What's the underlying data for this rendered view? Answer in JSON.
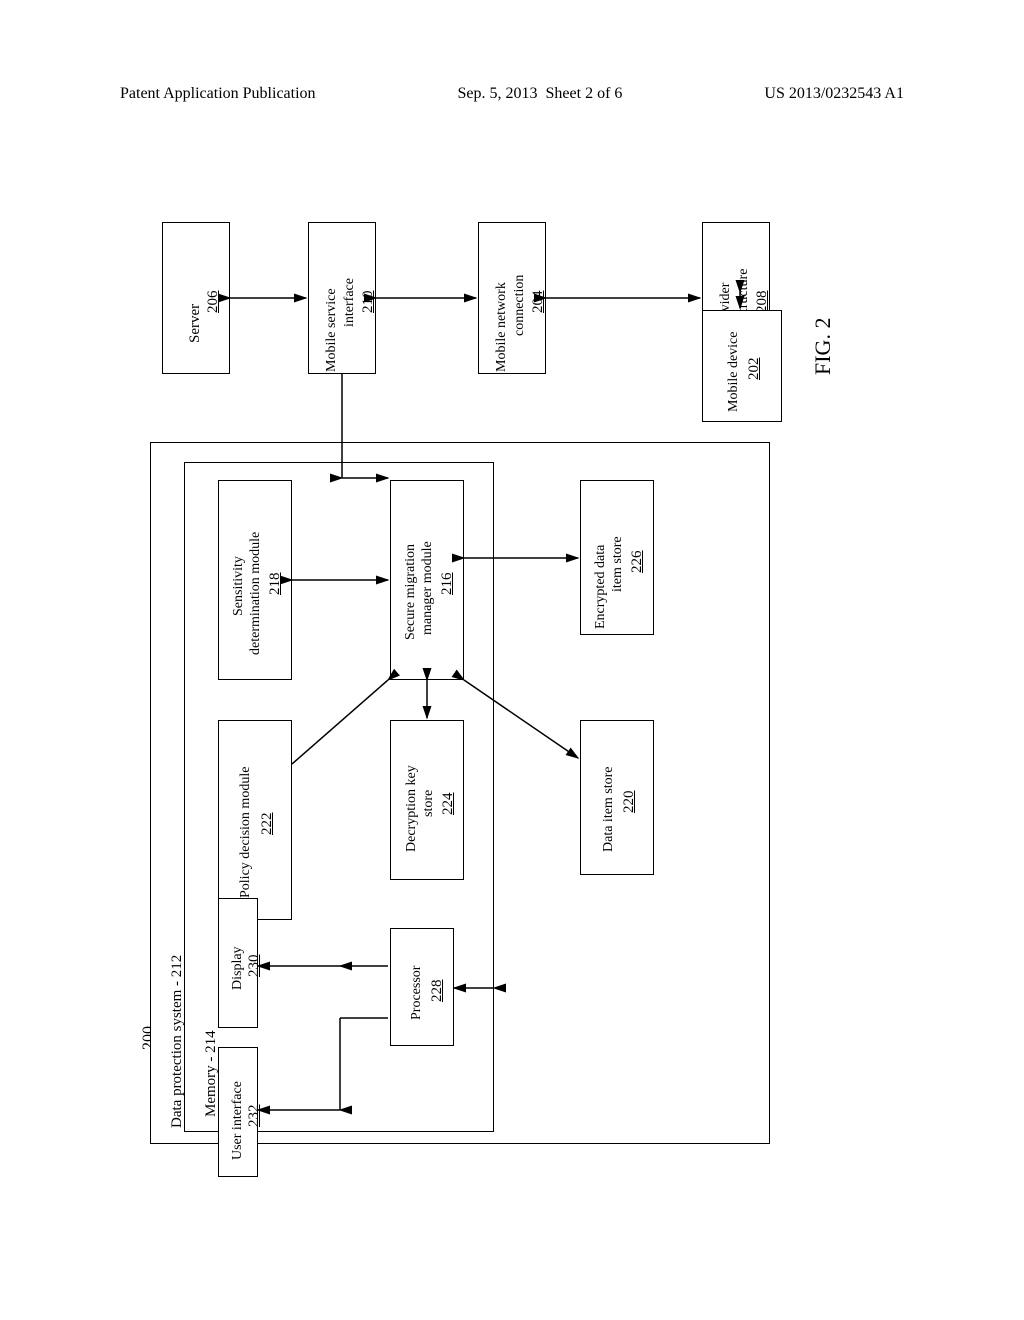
{
  "header": {
    "left": "Patent Application Publication",
    "center_date": "Sep. 5, 2013",
    "center_sheet": "Sheet 2 of 6",
    "right": "US 2013/0232543 A1"
  },
  "figure": {
    "number_label": "200",
    "caption": "FIG. 2",
    "boxes": {
      "server": {
        "label": "Server",
        "ref": "206"
      },
      "msi": {
        "label": "Mobile service interface",
        "ref": "210"
      },
      "mnc": {
        "label": "Mobile network connection",
        "ref": "204"
      },
      "mpi": {
        "label": "Mobile provider infrastructure",
        "ref": "208"
      },
      "mdev": {
        "label": "Mobile device",
        "ref": "202"
      },
      "dps": {
        "label": "Data protection system - 212"
      },
      "mem": {
        "label": "Memory - 214"
      },
      "sens": {
        "label": "Sensitivity determination module",
        "ref": "218"
      },
      "smm": {
        "label": "Secure migration manager module",
        "ref": "216"
      },
      "enc": {
        "label": "Encrypted data item store",
        "ref": "226"
      },
      "pdm": {
        "label": "Policy decision module",
        "ref": "222"
      },
      "dks": {
        "label": "Decryption key store",
        "ref": "224"
      },
      "dis": {
        "label": "Data item store",
        "ref": "220"
      },
      "proc": {
        "label": "Processor",
        "ref": "228"
      },
      "disp": {
        "label": "Display",
        "ref": "230"
      },
      "ui": {
        "label": "User interface",
        "ref": "232"
      }
    }
  }
}
